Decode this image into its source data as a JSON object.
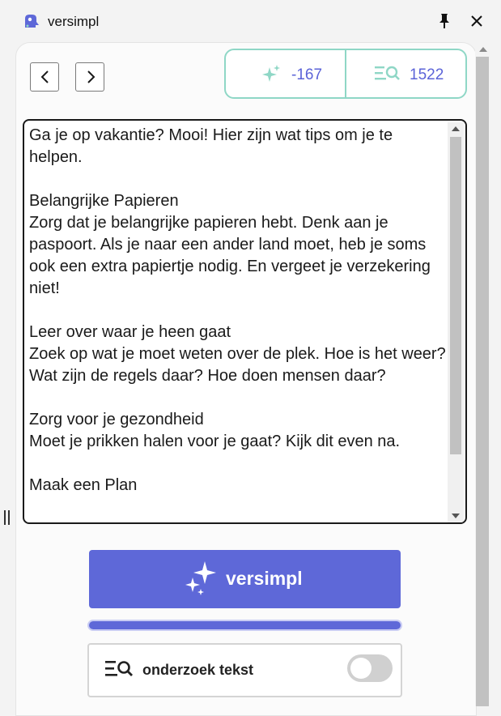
{
  "app": {
    "title": "versimpl",
    "colors": {
      "accent": "#5e68d8",
      "teal": "#8fd7c6"
    }
  },
  "nav": {
    "back_icon": "chevron-left-icon",
    "forward_icon": "chevron-right-icon"
  },
  "stats": {
    "simplify_delta": "-167",
    "simplify_icon": "sparkles-icon",
    "research_count": "1522",
    "research_icon": "search-list-icon"
  },
  "editor": {
    "paragraphs": [
      [
        "Ga je op vakantie? Mooi! Hier zijn wat tips om je te helpen."
      ],
      [
        "Belangrijke Papieren",
        "Zorg dat je belangrijke papieren hebt. Denk aan je paspoort. Als je naar een ander land moet, heb je soms ook een extra papiertje nodig. En vergeet je verzekering niet!"
      ],
      [
        "Leer over waar je heen gaat",
        "Zoek op wat je moet weten over de plek. Hoe is het weer? Wat zijn de regels daar? Hoe doen mensen daar?"
      ],
      [
        "Zorg voor je gezondheid",
        "Moet je prikken halen voor je gaat? Kijk dit even na."
      ],
      [
        "Maak een Plan"
      ]
    ]
  },
  "primary_button": {
    "label": "versimpl",
    "icon": "sparkles-icon"
  },
  "progress": {
    "value": 1.0
  },
  "research_toggle": {
    "label": "onderzoek tekst",
    "icon": "search-list-icon",
    "enabled": false
  }
}
